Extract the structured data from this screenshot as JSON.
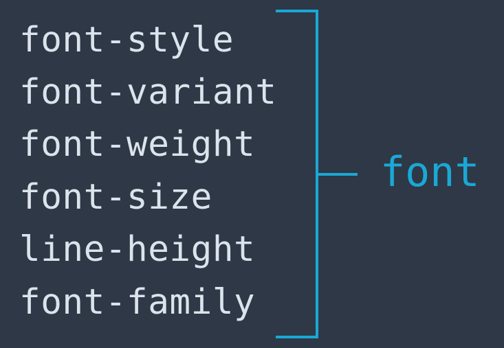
{
  "diagram": {
    "longhand_properties": [
      "font-style",
      "font-variant",
      "font-weight",
      "font-size",
      "line-height",
      "font-family"
    ],
    "shorthand_property": "font",
    "colors": {
      "background": "#2e3846",
      "text": "#dbe3ec",
      "accent": "#1aa8d6"
    }
  }
}
